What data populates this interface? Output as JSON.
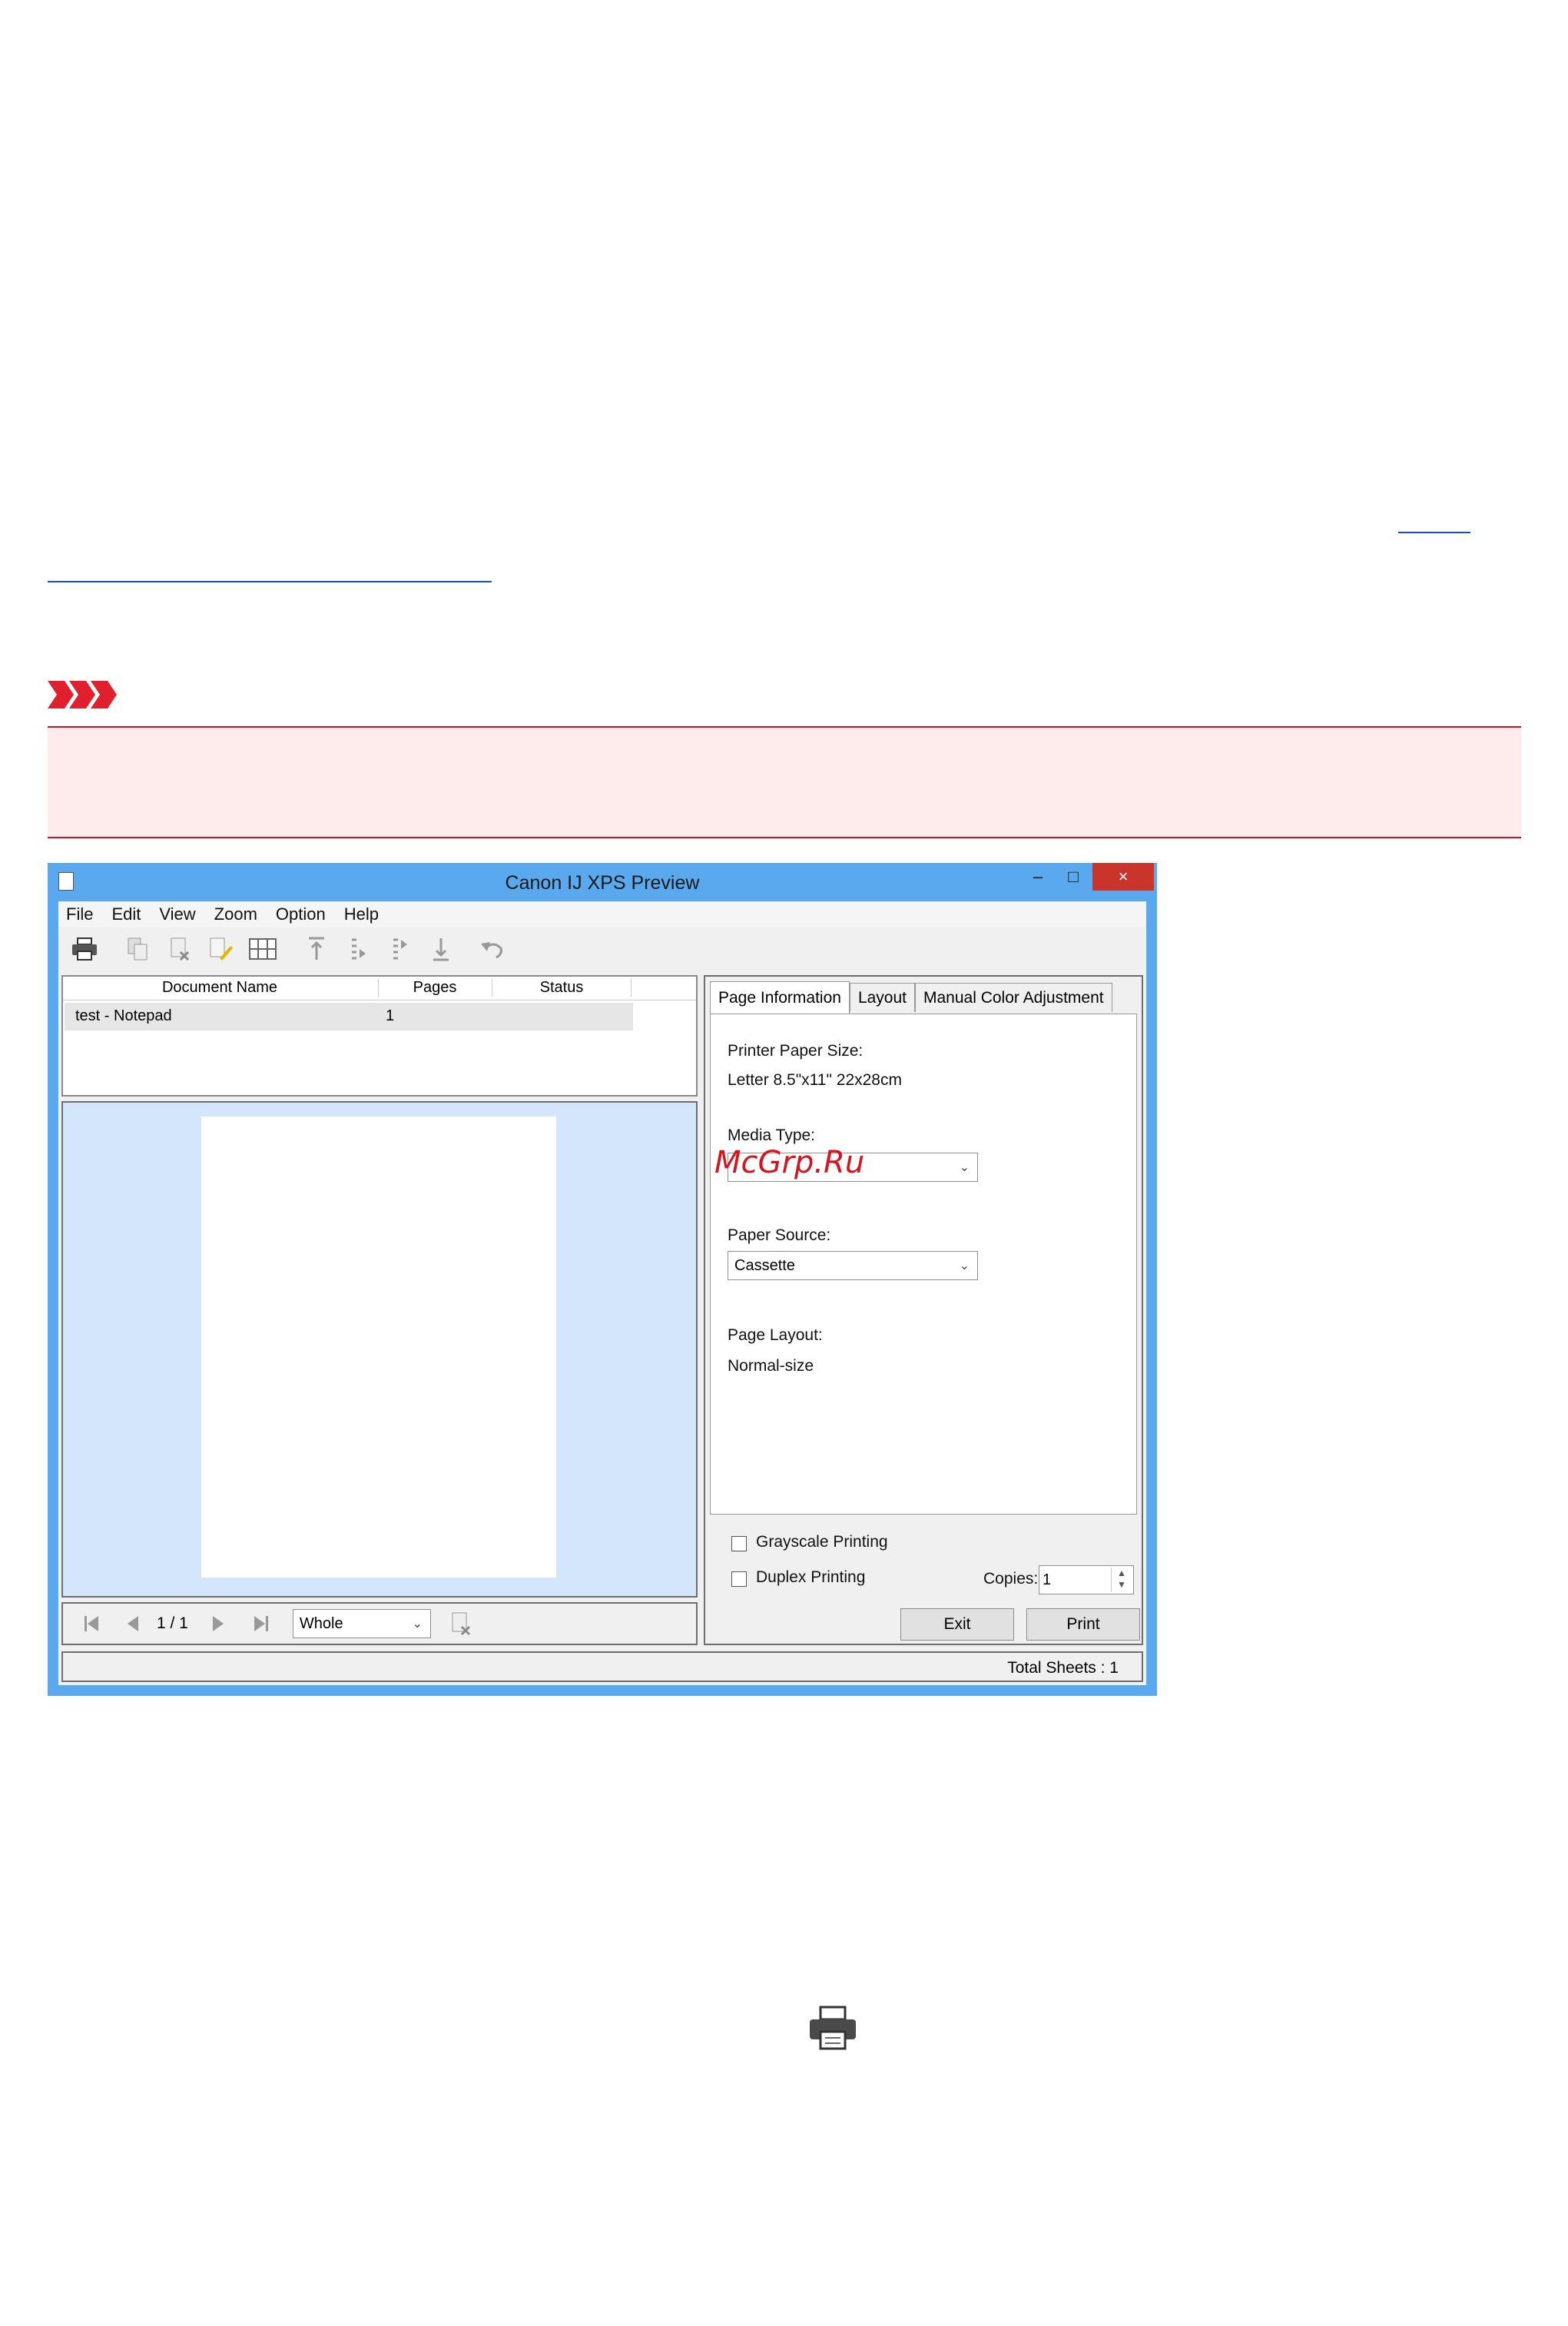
{
  "window": {
    "title": "Canon IJ XPS Preview",
    "sys_buttons": {
      "minimize": "–",
      "maximize": "□",
      "close": "×"
    }
  },
  "menu": [
    "File",
    "Edit",
    "View",
    "Zoom",
    "Option",
    "Help"
  ],
  "toolbar": {
    "icons": [
      "printer-icon",
      "copy-page-icon",
      "delete-page-icon",
      "edit-page-icon",
      "thumbnail-icon",
      "move-to-first-icon",
      "move-up-icon",
      "move-down-icon",
      "move-to-last-icon",
      "undo-icon"
    ]
  },
  "document_list": {
    "columns": [
      "Document Name",
      "Pages",
      "Status"
    ],
    "rows": [
      {
        "name": "test - Notepad",
        "pages": "1",
        "status": ""
      }
    ]
  },
  "navigation": {
    "page_indicator": "1 / 1",
    "zoom_value": "Whole"
  },
  "tabs": [
    "Page Information",
    "Layout",
    "Manual Color Adjustment"
  ],
  "page_information": {
    "paper_size_label": "Printer Paper Size:",
    "paper_size_value": "Letter 8.5\"x11\" 22x28cm",
    "media_type_label": "Media Type:",
    "media_type_value": "",
    "paper_source_label": "Paper Source:",
    "paper_source_value": "Cassette",
    "page_layout_label": "Page Layout:",
    "page_layout_value": "Normal-size"
  },
  "options": {
    "grayscale_label": "Grayscale Printing",
    "duplex_label": "Duplex Printing",
    "copies_label": "Copies:",
    "copies_value": "1"
  },
  "buttons": {
    "exit": "Exit",
    "print": "Print"
  },
  "status": {
    "total_sheets": "Total Sheets : 1"
  },
  "watermark": "McGrp.Ru"
}
